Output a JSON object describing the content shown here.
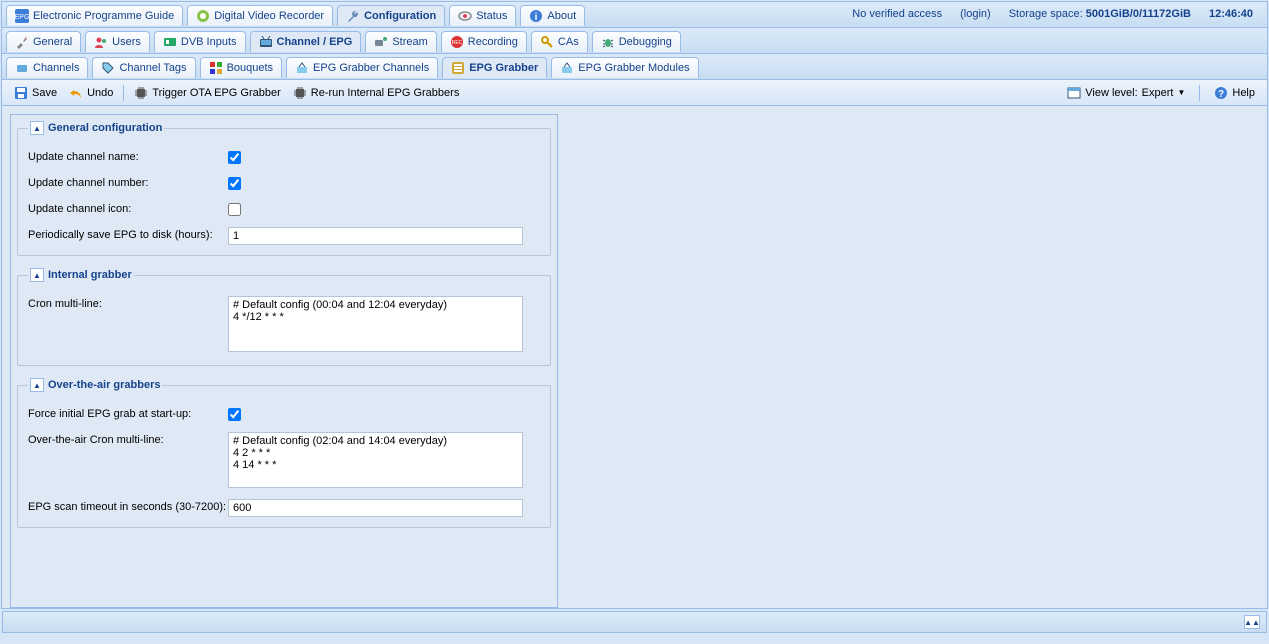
{
  "topTabs": [
    {
      "label": "Electronic Programme Guide"
    },
    {
      "label": "Digital Video Recorder"
    },
    {
      "label": "Configuration",
      "active": true
    },
    {
      "label": "Status"
    },
    {
      "label": "About"
    }
  ],
  "topRight": {
    "access": "No verified access",
    "login": "(login)",
    "storage_label": "Storage space:",
    "storage_value": "5001GiB/0/11172GiB",
    "time": "12:46:40"
  },
  "configTabs": [
    {
      "label": "General"
    },
    {
      "label": "Users"
    },
    {
      "label": "DVB Inputs"
    },
    {
      "label": "Channel / EPG",
      "active": true
    },
    {
      "label": "Stream"
    },
    {
      "label": "Recording"
    },
    {
      "label": "CAs"
    },
    {
      "label": "Debugging"
    }
  ],
  "channelTabs": [
    {
      "label": "Channels"
    },
    {
      "label": "Channel Tags"
    },
    {
      "label": "Bouquets"
    },
    {
      "label": "EPG Grabber Channels"
    },
    {
      "label": "EPG Grabber",
      "active": true
    },
    {
      "label": "EPG Grabber Modules"
    }
  ],
  "toolbar": {
    "save": "Save",
    "undo": "Undo",
    "trigger": "Trigger OTA EPG Grabber",
    "rerun": "Re-run Internal EPG Grabbers",
    "viewlevel_label": "View level:",
    "viewlevel_value": "Expert",
    "help": "Help"
  },
  "fieldsets": {
    "general": {
      "title": "General configuration",
      "update_channel_name": {
        "label": "Update channel name:",
        "checked": true
      },
      "update_channel_number": {
        "label": "Update channel number:",
        "checked": true
      },
      "update_channel_icon": {
        "label": "Update channel icon:",
        "checked": false
      },
      "save_epg": {
        "label": "Periodically save EPG to disk (hours):",
        "value": "1"
      }
    },
    "internal": {
      "title": "Internal grabber",
      "cron": {
        "label": "Cron multi-line:",
        "value": "# Default config (00:04 and 12:04 everyday)\n4 */12 * * *"
      }
    },
    "ota": {
      "title": "Over-the-air grabbers",
      "force": {
        "label": "Force initial EPG grab at start-up:",
        "checked": true
      },
      "cron": {
        "label": "Over-the-air Cron multi-line:",
        "value": "# Default config (02:04 and 14:04 everyday)\n4 2 * * *\n4 14 * * *"
      },
      "timeout": {
        "label": "EPG scan timeout in seconds (30-7200):",
        "value": "600"
      }
    }
  }
}
